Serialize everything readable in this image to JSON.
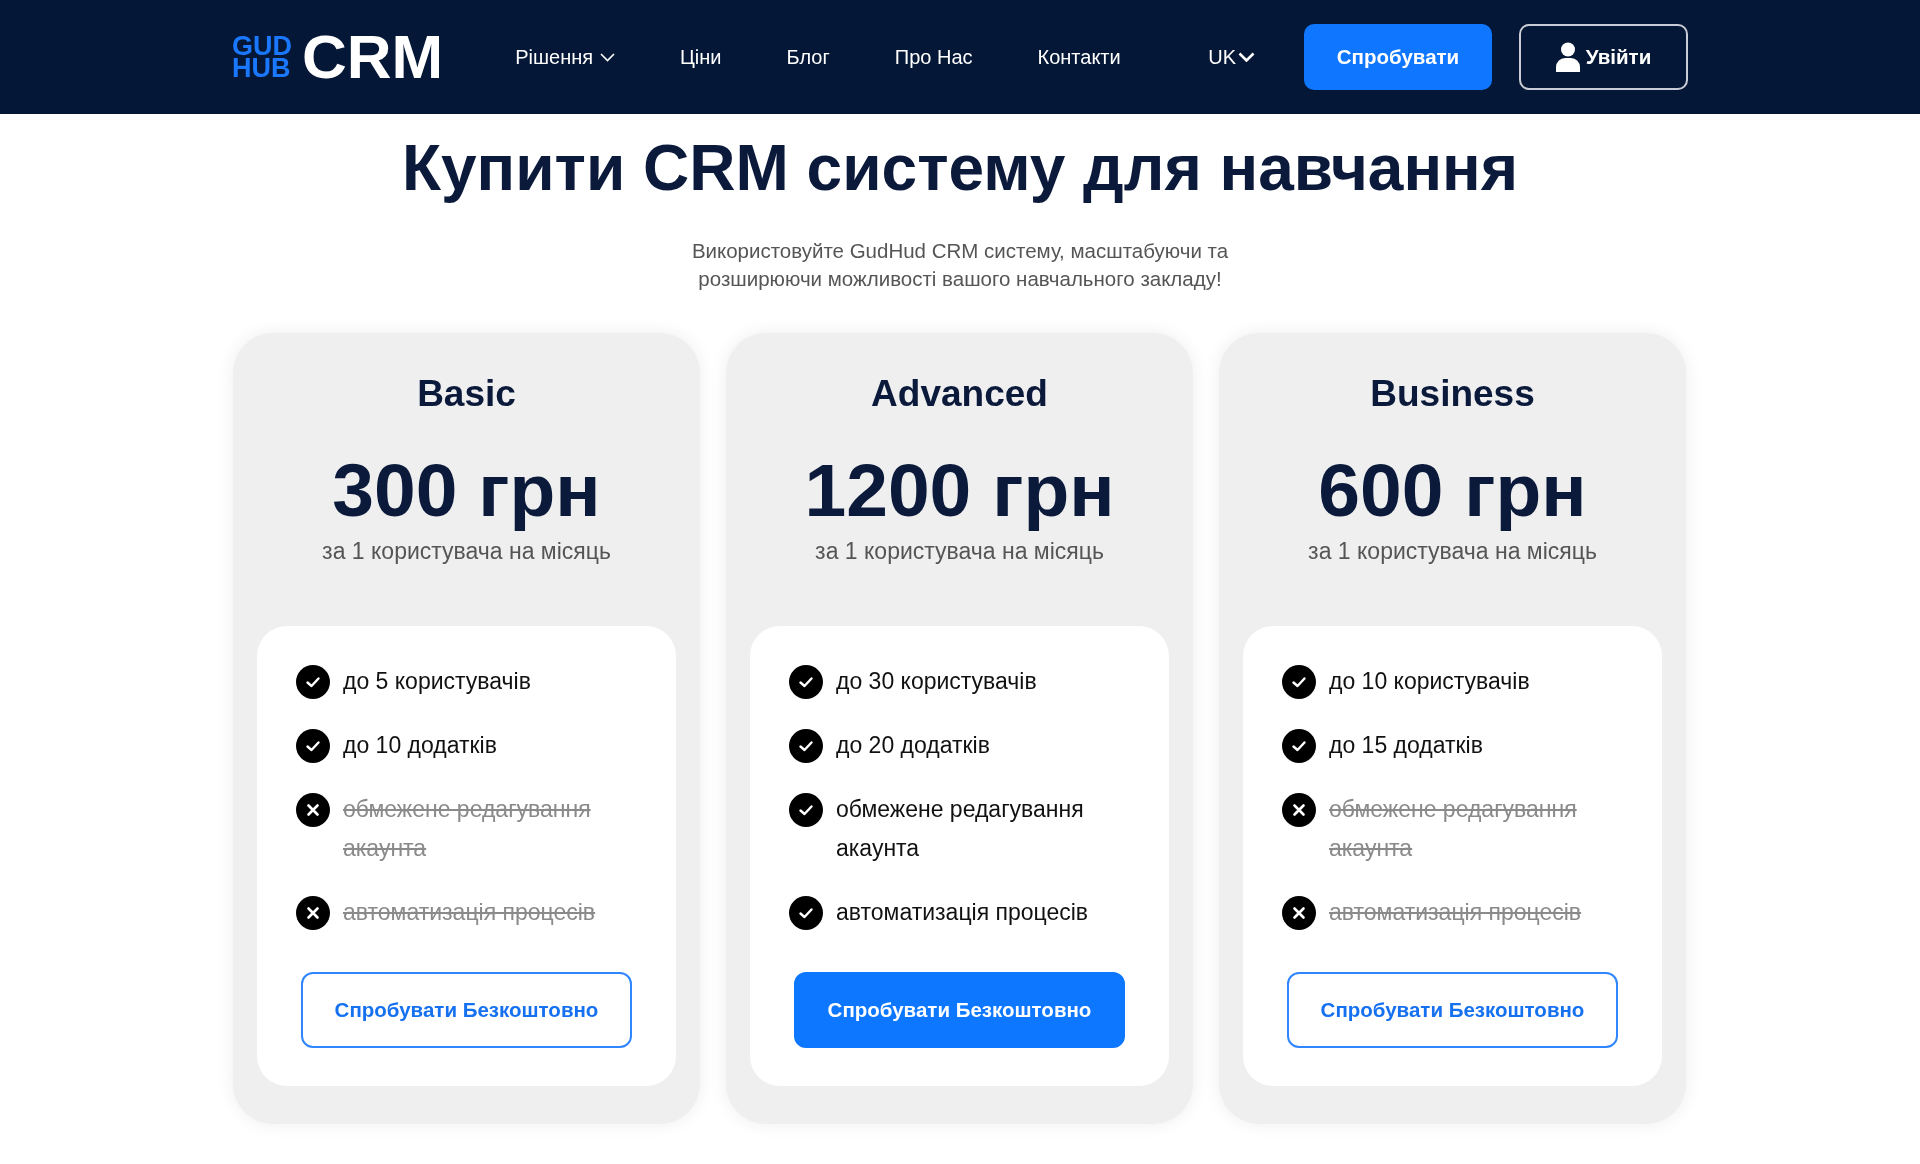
{
  "header": {
    "logo": {
      "top": "GUD",
      "bottom": "HUB",
      "name": "CRM"
    },
    "nav": [
      {
        "label": "Рішення",
        "dropdown": true
      },
      {
        "label": "Ціни",
        "dropdown": false
      },
      {
        "label": "Блог",
        "dropdown": false
      },
      {
        "label": "Про Нас",
        "dropdown": false
      },
      {
        "label": "Контакти",
        "dropdown": false
      }
    ],
    "language": "UK",
    "try_button": "Спробувати",
    "login_button": "Увійти"
  },
  "hero": {
    "title": "Купити CRM систему для навчання",
    "subtitle": "Використовуйте GudHud CRM систему, масштабуючи та розширюючи можливості вашого навчального закладу!"
  },
  "plans": [
    {
      "name": "Basic",
      "price": "300 грн",
      "period": "за 1 користувача на місяць",
      "features": [
        {
          "text": "до 5 користувачів",
          "included": true
        },
        {
          "text": "до 10 додатків",
          "included": true
        },
        {
          "text": "обмежене редагування акаунта",
          "included": false
        },
        {
          "text": "автоматизація процесів",
          "included": false
        }
      ],
      "button": {
        "label": "Спробувати Безкоштовно",
        "primary": false
      }
    },
    {
      "name": "Advanced",
      "price": "1200 грн",
      "period": "за 1 користувача на місяць",
      "features": [
        {
          "text": "до 30 користувачів",
          "included": true
        },
        {
          "text": "до 20 додатків",
          "included": true
        },
        {
          "text": "обмежене редагування акаунта",
          "included": true
        },
        {
          "text": "автоматизація процесів",
          "included": true
        }
      ],
      "button": {
        "label": "Спробувати Безкоштовно",
        "primary": true
      }
    },
    {
      "name": "Business",
      "price": "600 грн",
      "period": "за 1 користувача на місяць",
      "features": [
        {
          "text": "до 10 користувачів",
          "included": true
        },
        {
          "text": "до 15 додатків",
          "included": true
        },
        {
          "text": "обмежене редагування акаунта",
          "included": false
        },
        {
          "text": "автоматизація процесів",
          "included": false
        }
      ],
      "button": {
        "label": "Спробувати Безкоштовно",
        "primary": false
      }
    }
  ]
}
